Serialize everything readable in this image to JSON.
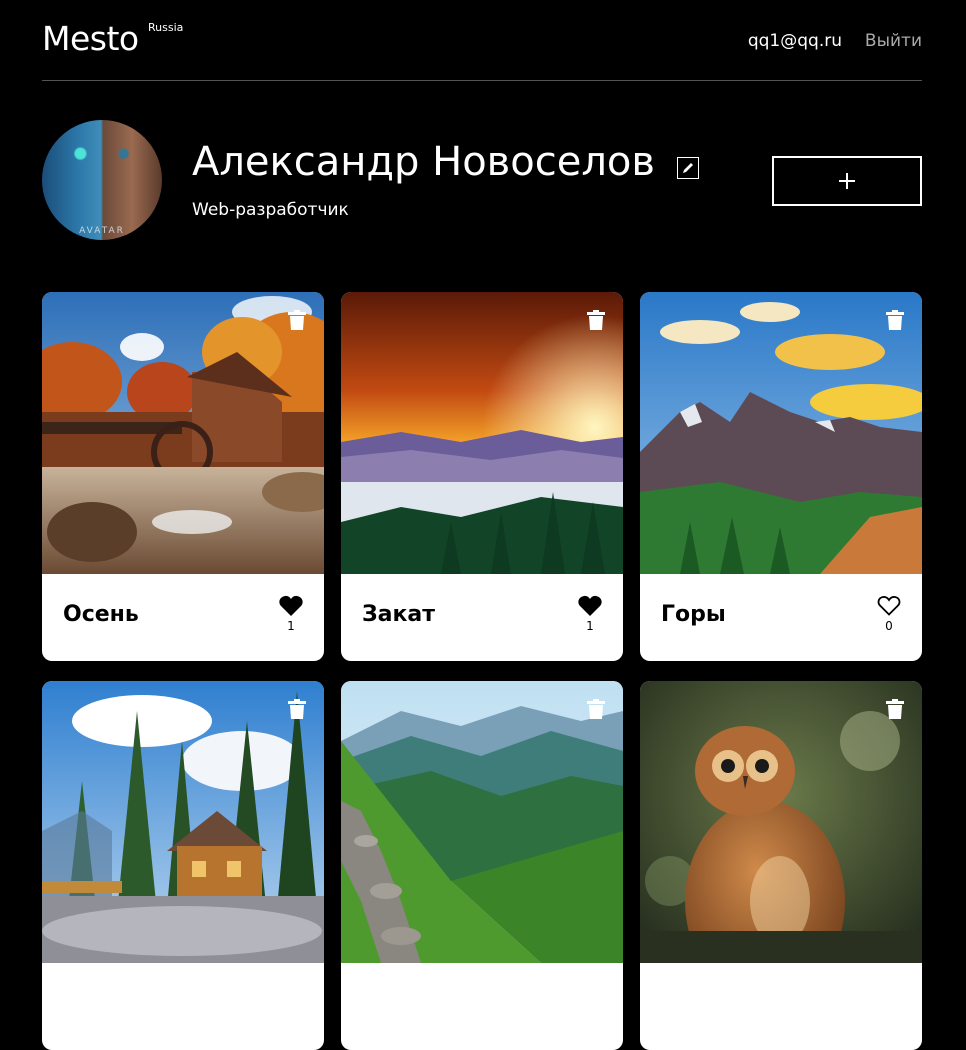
{
  "header": {
    "logo": "Mesto",
    "logo_country": "Russia",
    "email": "qq1@qq.ru",
    "logout_label": "Выйти"
  },
  "profile": {
    "name": "Александр Новоселов",
    "about": "Web-разработчик",
    "avatar_caption": "AVATAR",
    "edit_icon": "pencil-icon",
    "add_icon": "plus-icon"
  },
  "cards": [
    {
      "title": "Осень",
      "likes": "1",
      "liked": true,
      "image": "autumn-mill"
    },
    {
      "title": "Закат",
      "likes": "1",
      "liked": true,
      "image": "sunset-valley"
    },
    {
      "title": "Горы",
      "likes": "0",
      "liked": false,
      "image": "mountains"
    },
    {
      "title": "",
      "likes": "",
      "liked": false,
      "image": "forest-cabin"
    },
    {
      "title": "",
      "likes": "",
      "liked": false,
      "image": "green-valley"
    },
    {
      "title": "",
      "likes": "",
      "liked": false,
      "image": "owl"
    }
  ],
  "colors": {
    "background": "#000000",
    "card": "#ffffff",
    "header_divider": "#545454",
    "logout_text": "#a9a9a9"
  }
}
